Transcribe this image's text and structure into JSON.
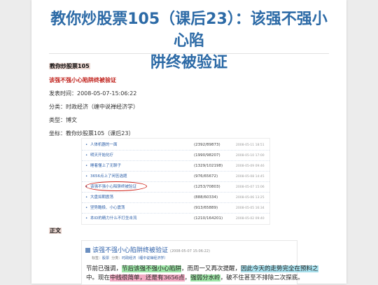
{
  "article": {
    "title_line1": "教你炒股票105（课后23）：该强不强小心陷",
    "title_line2": "阱终被验证",
    "series_name": "教你炒股票105",
    "subtitle": "该强不强小心陷阱终被验证",
    "published": "发表时间：2008-05-07-15:06:22",
    "category": "分类：时政经济（缠中说禅经济学）",
    "type": "类型：博文",
    "coordinate": "坐标：教你炒股票105（课后23）",
    "body_label": "正文"
  },
  "list_screenshot": {
    "items": [
      {
        "title": "人体机器的一面",
        "stats": "(2392/89873)",
        "date": "2008-05-11 18:51"
      },
      {
        "title": "明天开始化疗",
        "stats": "(1990/98207)",
        "date": "2008-05-10 17:00"
      },
      {
        "title": "睡着懂上了无聊子",
        "stats": "(1329/102198)",
        "date": "2008-05-09 09:46"
      },
      {
        "title": "3656点上了闲苦选题",
        "stats": "(976/65672)",
        "date": "2008-05-08 14:45"
      },
      {
        "title": "该强不强小心陷阱终被验证",
        "stats": "(1253/70803)",
        "date": "2008-05-07 15:06"
      },
      {
        "title": "大盘如期震荡",
        "stats": "(888/60334)",
        "date": "2008-05-06 13:25"
      },
      {
        "title": "坚势酷极、小心震荡",
        "stats": "(913/65889)",
        "date": "2008-05-05 16:34"
      },
      {
        "title": "本ID的精力什么不打坐击流",
        "stats": "(1210/164201)",
        "date": "2008-05-02 09:40"
      }
    ],
    "highlight_color": "#d0241b"
  },
  "article_preview": {
    "heading": "该强不强小心陷阱终被验证",
    "heading_date": "(2008-05-07 15:06:22)",
    "sub_prefix": "标签：",
    "sub_tag": "股票",
    "sub_mid": "分类：",
    "sub_category": "时政经济（缠中说禅经济学）",
    "line1": [
      {
        "text": "节前已强调，",
        "hl": ""
      },
      {
        "text": "节后该强不强小心陷阱",
        "hl": "g"
      },
      {
        "text": "，而周一又再次提醒，",
        "hl": ""
      },
      {
        "text": "因此今天的走势完全在预料之",
        "hl": "c"
      }
    ],
    "line2": [
      {
        "text": "中。现在",
        "hl": ""
      },
      {
        "text": "中线很简单，还是有3656点",
        "hl": "p"
      },
      {
        "text": "，",
        "hl": ""
      },
      {
        "text": "强弱分水岭",
        "hl": "g"
      },
      {
        "text": "，破不住甚至不排除二次探底。",
        "hl": ""
      }
    ]
  }
}
